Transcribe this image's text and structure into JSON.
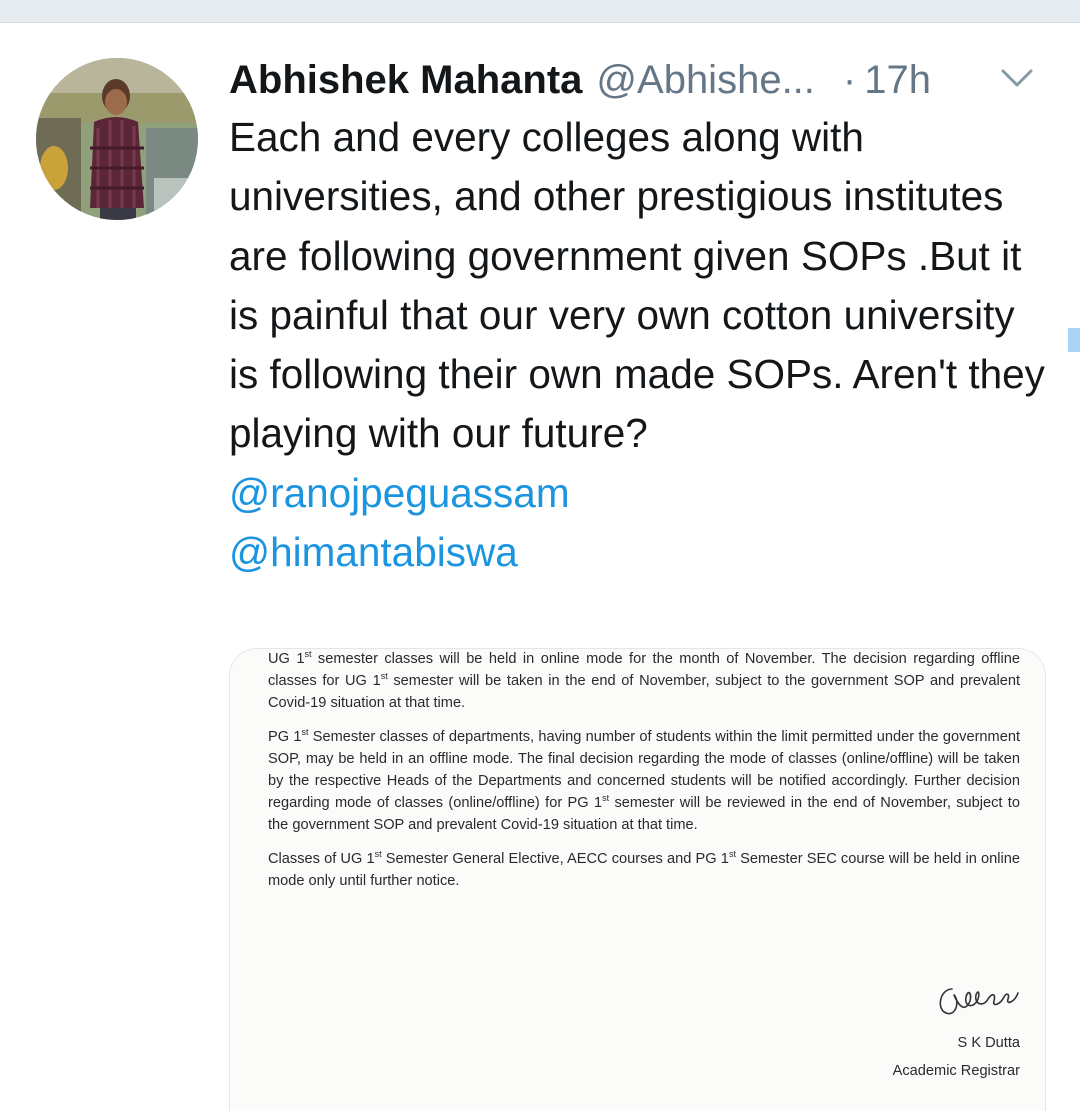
{
  "tweet": {
    "author_name": "Abhishek Mahanta",
    "author_handle": "@Abhishe...",
    "separator": "·",
    "time": "17h",
    "text": "Each and every colleges along with universities, and other prestigious institutes are following government given SOPs .But it is painful that our very own cotton university is following their own made SOPs. Aren't they playing with our future?",
    "mentions": [
      "@ranojpeguassam",
      "@himantabiswa"
    ]
  },
  "document": {
    "para1_a": "UG 1",
    "para1_sup1": "st",
    "para1_b": " semester classes will be held in online mode for the month of November. The decision regarding offline classes for UG 1",
    "para1_sup2": "st",
    "para1_c": " semester will be taken in the end of November, subject to the government SOP and prevalent Covid-19 situation at that time.",
    "para2_a": "PG 1",
    "para2_sup1": "st",
    "para2_b": " Semester classes of departments, having number of students within the limit permitted under the government SOP, may be held in an offline mode. The final decision regarding the mode of classes (online/offline) will be taken by the respective Heads of the Departments and concerned students will be notified accordingly. Further decision regarding mode of classes (online/offline) for PG 1",
    "para2_sup2": "st",
    "para2_c": " semester will be reviewed in the end of November, subject to the government SOP and prevalent Covid-19 situation at that time.",
    "para3_a": "Classes of UG 1",
    "para3_sup1": "st",
    "para3_b": " Semester General Elective, AECC courses and PG 1",
    "para3_sup2": "st",
    "para3_c": " Semester SEC course will be held in online mode only until further notice.",
    "signer_name": "S K Dutta",
    "signer_title": "Academic Registrar"
  },
  "icons": {
    "avatar": "avatar-photo",
    "caret": "chevron-down-icon",
    "signature": "handwritten-signature"
  },
  "colors": {
    "link": "#1b95e0",
    "text": "#14171a",
    "muted": "#657786"
  }
}
